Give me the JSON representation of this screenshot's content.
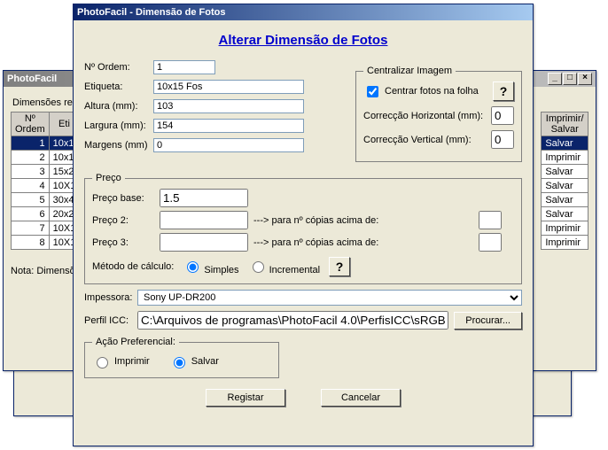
{
  "bgwin1": {
    "title": "PhotoFacil"
  },
  "bgwin2": {
    "title": "PhotoFacil",
    "table_label": "Dimensões regi",
    "note": "Nota: Dimensõ",
    "columns": {
      "ordem": "Nº\nOrdem",
      "etiqueta": "Eti",
      "imprimir": "Imprimir/\nSalvar"
    },
    "rows": [
      {
        "ordem": "1",
        "etq": "10x1",
        "action": "Salvar"
      },
      {
        "ordem": "2",
        "etq": "10x1",
        "action": "Imprimir"
      },
      {
        "ordem": "3",
        "etq": "15x2",
        "action": "Salvar"
      },
      {
        "ordem": "4",
        "etq": "10X1",
        "action": "Salvar"
      },
      {
        "ordem": "5",
        "etq": "30x4",
        "action": "Salvar"
      },
      {
        "ordem": "6",
        "etq": "20x2",
        "action": "Salvar"
      },
      {
        "ordem": "7",
        "etq": "10X1",
        "action": "Imprimir"
      },
      {
        "ordem": "8",
        "etq": "10X1",
        "action": "Imprimir"
      }
    ]
  },
  "dialog": {
    "title": "PhotoFacil - Dimensão de Fotos",
    "header_link": "Alterar Dimensão de Fotos",
    "fields": {
      "ordem_label": "Nº Ordem:",
      "ordem_value": "1",
      "etiqueta_label": "Etiqueta:",
      "etiqueta_value": "10x15 Fos",
      "altura_label": "Altura (mm):",
      "altura_value": "103",
      "largura_label": "Largura (mm):",
      "largura_value": "154",
      "margens_label": "Margens (mm)",
      "margens_value": "0"
    },
    "centralizar": {
      "legend": "Centralizar Imagem",
      "checkbox_label": "Centrar fotos na folha",
      "checked": true,
      "help": "?",
      "corr_h_label": "Correcção Horizontal (mm):",
      "corr_h_value": "0",
      "corr_v_label": "Correcção Vertical (mm):",
      "corr_v_value": "0"
    },
    "preco": {
      "legend": "Preço",
      "base_label": "Preço base:",
      "base_value": "1.5",
      "p2_label": "Preço 2:",
      "p2_value": "",
      "p3_label": "Preço 3:",
      "p3_value": "",
      "copies_hint": "---> para nº cópias acima de:",
      "method_label": "Método de cálculo:",
      "method_simple": "Simples",
      "method_incremental": "Incremental",
      "help": "?"
    },
    "impressora_label": "Impessora:",
    "impressora_value": "Sony UP-DR200",
    "icc_label": "Perfil ICC:",
    "icc_value": "C:\\Arquivos de programas\\PhotoFacil 4.0\\PerfisICC\\sRGB.icm",
    "browse_label": "Procurar...",
    "acao": {
      "legend": "Ação Preferencial:",
      "imprimir": "Imprimir",
      "salvar": "Salvar"
    },
    "buttons": {
      "registar": "Registar",
      "cancelar": "Cancelar"
    },
    "win_controls": {
      "minimize": "_",
      "maximize": "□",
      "close": "×"
    }
  }
}
